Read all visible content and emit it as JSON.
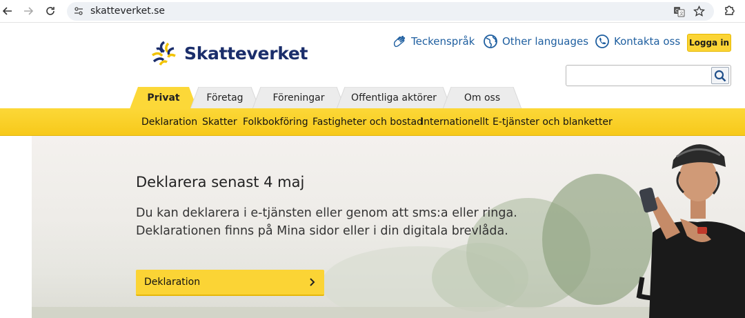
{
  "browser": {
    "url": "skatteverket.se"
  },
  "header": {
    "logo_text": "Skatteverket",
    "links": [
      {
        "label": "Teckenspråk",
        "icon": "sign-language-icon"
      },
      {
        "label": "Other languages",
        "icon": "globe-icon"
      },
      {
        "label": "Kontakta oss",
        "icon": "contact-icon"
      }
    ],
    "login_label": "Logga in",
    "search_value": ""
  },
  "tabs": [
    {
      "label": "Privat",
      "active": true
    },
    {
      "label": "Företag",
      "active": false
    },
    {
      "label": "Föreningar",
      "active": false
    },
    {
      "label": "Offentliga aktörer",
      "active": false
    },
    {
      "label": "Om oss",
      "active": false
    }
  ],
  "subnav": [
    "Deklaration",
    "Skatter",
    "Folkbokföring",
    "Fastigheter och bostad",
    "Internationellt",
    "E-tjänster och blanketter"
  ],
  "hero": {
    "title": "Deklarera senast 4 maj",
    "text_line1": "Du kan deklarera i e-tjänsten eller genom att sms:a eller ringa.",
    "text_line2": "Deklarationen finns på Mina sidor eller i din digitala brevlåda.",
    "button_label": "Deklaration"
  },
  "colors": {
    "brand_yellow": "#fbd435",
    "brand_navy": "#1b2e6b",
    "link_blue": "#1f5fa0"
  }
}
